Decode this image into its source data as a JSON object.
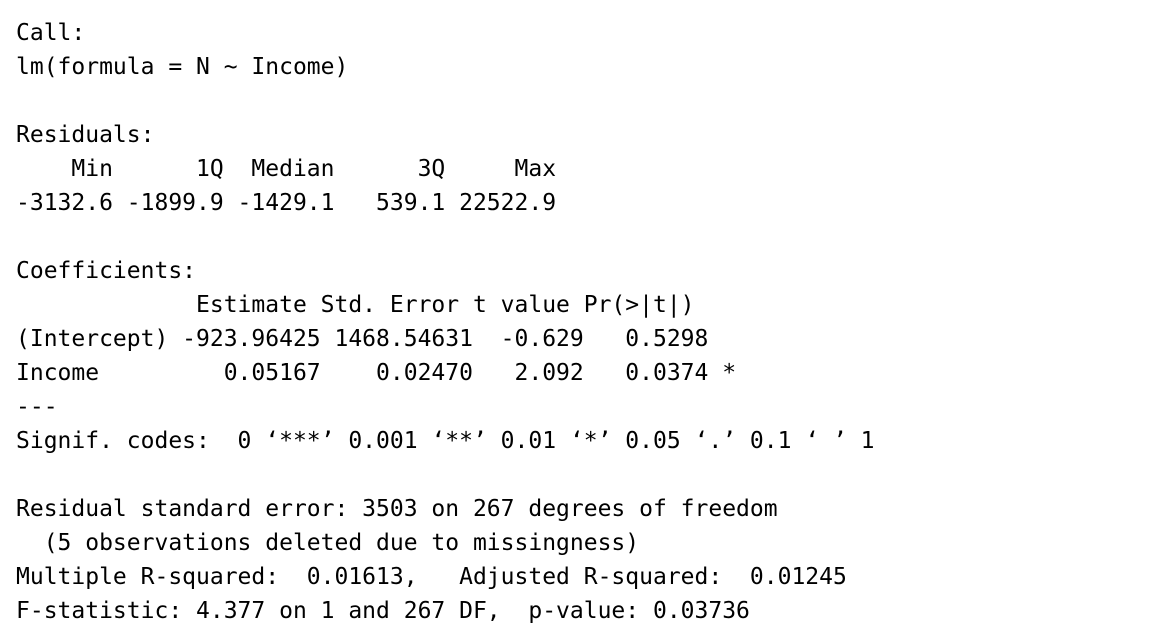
{
  "call": {
    "header": "Call:",
    "formula": "lm(formula = N ~ Income)"
  },
  "residuals": {
    "header": "Residuals:",
    "labels_line": "    Min      1Q  Median      3Q     Max ",
    "values_line": "-3132.6 -1899.9 -1429.1   539.1 22522.9 "
  },
  "coefficients": {
    "header": "Coefficients:",
    "columns_line": "             Estimate Std. Error t value Pr(>|t|)  ",
    "rows": [
      "(Intercept) -923.96425 1468.54631  -0.629   0.5298  ",
      "Income         0.05167    0.02470   2.092   0.0374 *"
    ],
    "separator": "---",
    "signif_codes": "Signif. codes:  0 ‘***’ 0.001 ‘**’ 0.01 ‘*’ 0.05 ‘.’ 0.1 ‘ ’ 1"
  },
  "summary": {
    "rse": "Residual standard error: 3503 on 267 degrees of freedom",
    "deleted": "  (5 observations deleted due to missingness)",
    "r_squared": "Multiple R-squared:  0.01613,\tAdjusted R-squared:  0.01245 ",
    "f_statistic": "F-statistic: 4.377 on 1 and 267 DF,  p-value: 0.03736"
  }
}
